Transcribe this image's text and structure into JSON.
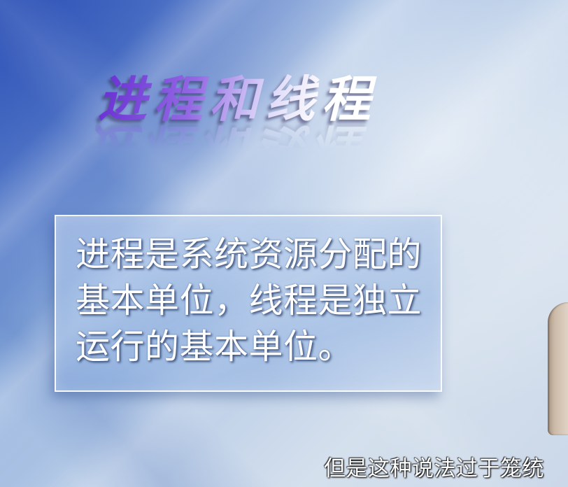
{
  "video": {
    "title": "进程和线程",
    "definition_box": {
      "lines": [
        "进程是系统资源分配的",
        "基本单位，线程是独立",
        "运行的基本单位。"
      ]
    },
    "subtitle": "但是这种说法过于笼统"
  },
  "colors": {
    "title_gradient_start": "#6b32d4",
    "title_gradient_end": "#ffffff",
    "background_dark": "#3a60c0",
    "background_light": "#d5e0ed",
    "text": "#ffffff"
  }
}
